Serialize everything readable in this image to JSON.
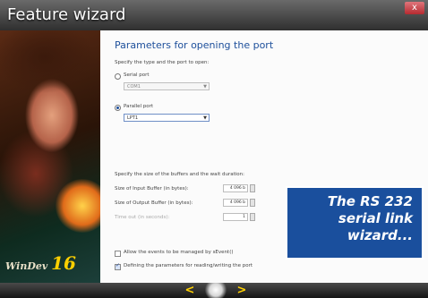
{
  "window": {
    "title": "Feature wizard",
    "close_glyph": "x"
  },
  "art": {
    "logo_text": "WinDev",
    "logo_number": "16"
  },
  "content": {
    "heading": "Parameters for opening the port",
    "intro": "Specify the type and the port to open:",
    "serial_port_label": "Serial port",
    "serial_port_value": "COM1",
    "parallel_port_label": "Parallel port",
    "parallel_port_value": "LPT1",
    "buffers_intro": "Specify the size of the buffers and the wait duration:",
    "input_buffer_label": "Size of Input Buffer (in bytes):",
    "input_buffer_value": "4 096 b",
    "output_buffer_label": "Size of Output Buffer (in bytes):",
    "output_buffer_value": "4 096 b",
    "timeout_label": "Time out (in seconds):",
    "timeout_value": "1",
    "events_label": "Allow the events to be managed by sEvent()",
    "define_params_label": "Defining the parameters for reading/writing the port",
    "define_params_checked": true
  },
  "caption": {
    "line1": "The RS 232",
    "line2": "serial link",
    "line3": "wizard..."
  },
  "nav": {
    "prev_glyph": "<",
    "next_glyph": ">"
  }
}
